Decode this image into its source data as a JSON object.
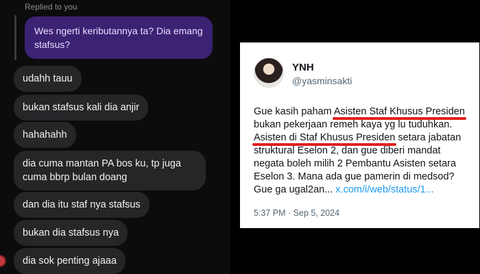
{
  "chat": {
    "replied_label": "Replied to you",
    "quoted_message": "Wes ngerti keributannya ta? Dia emang stafsus?",
    "messages": [
      "udahh tauu",
      "bukan stafsus kali dia anjir",
      "hahahahh",
      "dia cuma mantan PA bos ku, tp juga cuma bbrp bulan doang",
      "dan dia itu staf nya stafsus",
      "bukan dia stafsus nya",
      "dia sok penting ajaaa"
    ]
  },
  "tweet": {
    "name": "YNH",
    "handle": "@yasminsakti",
    "body_lines": [
      {
        "pre": "Gue kasih paham ",
        "mark": "Asisten Staf Khusus Presiden",
        "post": ""
      },
      {
        "pre": "bukan pekerjaan remeh kaya yg lu tuduhkan.",
        "mark": "",
        "post": ""
      },
      {
        "pre": "",
        "mark": "Asisten di Staf Khusus Presiden",
        "post": " setara jabatan"
      },
      {
        "pre": "struktural Eselon 2, dan gue diberi mandat",
        "mark": "",
        "post": ""
      },
      {
        "pre": "negata boleh milih 2 Pembantu Asisten setara",
        "mark": "",
        "post": ""
      },
      {
        "pre": "Eselon 3.  Mana ada gue pamerin di medsod?",
        "mark": "",
        "post": ""
      }
    ],
    "last_line_text": "Gue ga ugal2an... ",
    "link": "x.com/i/web/status/1...",
    "timestamp": "5:37 PM · Sep 5, 2024"
  }
}
